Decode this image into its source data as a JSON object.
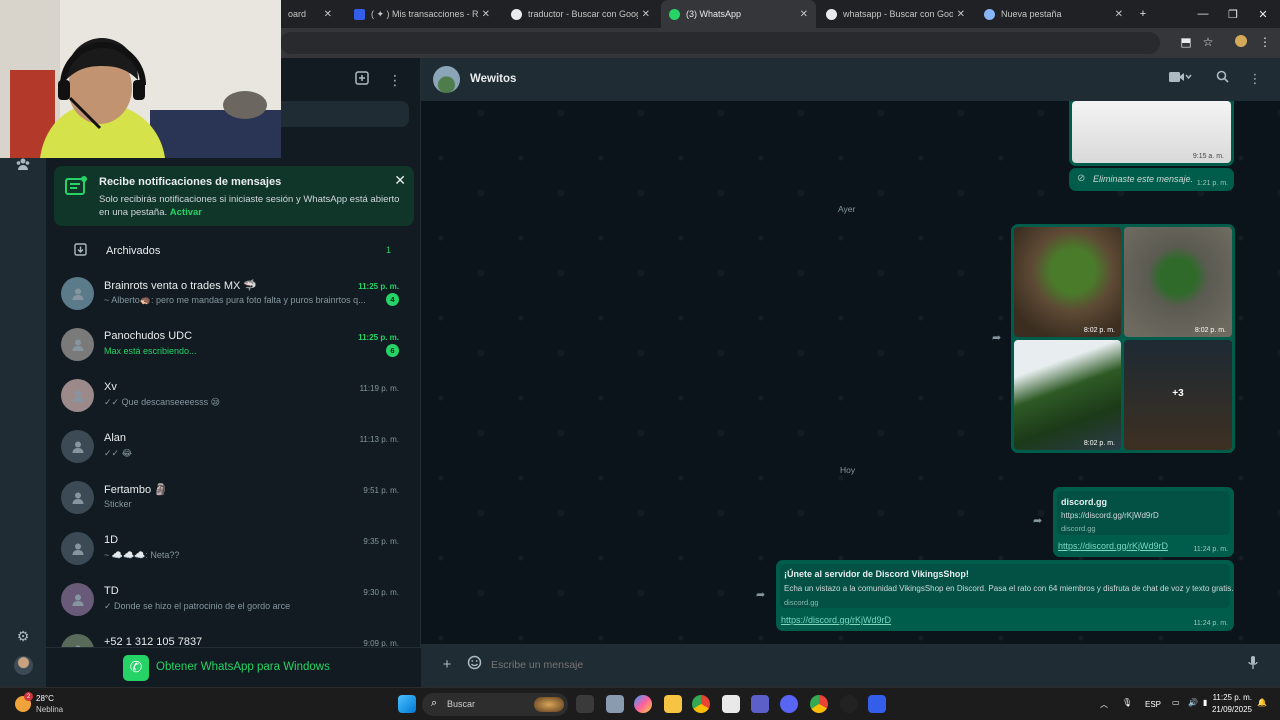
{
  "browser": {
    "tabs": [
      {
        "label": "oard",
        "active": false,
        "color": "#5f6368"
      },
      {
        "label": "( ✦ ) Mis transacciones - Roblo",
        "active": false,
        "color": "#335eea"
      },
      {
        "label": "traductor - Buscar con Google",
        "active": false,
        "color": "#e8eaed"
      },
      {
        "label": "(3) WhatsApp",
        "active": true,
        "color": "#25d366"
      },
      {
        "label": "whatsapp - Buscar con Google",
        "active": false,
        "color": "#e8eaed"
      },
      {
        "label": "Nueva pestaña",
        "active": false,
        "color": "#8ab4f8"
      }
    ],
    "new_tab_symbol": "+"
  },
  "notification": {
    "title": "Recibe notificaciones de mensajes",
    "body": "Solo recibirás notificaciones si iniciaste sesión y WhatsApp está abierto en una pestaña.",
    "action": "Activar"
  },
  "archived": {
    "label": "Archivados",
    "count": "1"
  },
  "chats": [
    {
      "name": "Brainrots venta o trades MX 🦈",
      "time": "11:25 p. m.",
      "time_green": true,
      "preview": "~ Alberto🦔: pero me mandas pura foto falta y puros brainrtos q...",
      "preview_green": false,
      "badge": "4",
      "avatar": "#5b7a8a"
    },
    {
      "name": "Panochudos UDC",
      "time": "11:25 p. m.",
      "time_green": true,
      "preview": "Max está escribiendo...",
      "preview_green": true,
      "badge": "6",
      "avatar": "#7a7a7a"
    },
    {
      "name": "Xv",
      "time": "11:19 p. m.",
      "time_green": false,
      "preview": "✓✓ Que descanseeeesss 😪",
      "preview_green": false,
      "badge": "",
      "avatar": "#9c8a8a"
    },
    {
      "name": "Alan",
      "time": "11:13 p. m.",
      "time_green": false,
      "preview": "✓✓ 😂",
      "preview_green": false,
      "badge": "",
      "avatar": "#3b4a54"
    },
    {
      "name": "Fertambo 🗿",
      "time": "9:51 p. m.",
      "time_green": false,
      "preview": "Sticker",
      "preview_green": false,
      "badge": "",
      "avatar": "#3b4a54"
    },
    {
      "name": "1D",
      "time": "9:35 p. m.",
      "time_green": false,
      "preview": "~ ☁️☁️☁️: Neta??",
      "preview_green": false,
      "badge": "",
      "avatar": "#3b4a54"
    },
    {
      "name": "TD",
      "time": "9:30 p. m.",
      "time_green": false,
      "preview": "✓ Donde se hizo el patrocinio de el gordo arce",
      "preview_green": false,
      "badge": "",
      "avatar": "#6a5a7a"
    },
    {
      "name": "+52 1 312 105 7837",
      "time": "9:09 p. m.",
      "time_green": false,
      "preview": "",
      "preview_green": false,
      "badge": "",
      "avatar": "#5a6a5a"
    }
  ],
  "get_app": {
    "label": "Obtener WhatsApp para Windows"
  },
  "chat": {
    "name": "Wewitos",
    "messages": {
      "top_image_time": "9:15 a. m.",
      "deleted_text": "Eliminaste este mensaje.",
      "deleted_time": "1:21 p. m.",
      "day_yesterday": "Ayer",
      "album_times": [
        "8:02 p. m.",
        "8:02 p. m.",
        "8:02 p. m."
      ],
      "album_more": "+3",
      "day_today": "Hoy",
      "msg1": {
        "title": "discord.gg",
        "desc": "https://discord.gg/rKjWd9rD",
        "domain": "discord.gg",
        "link": "https://discord.gg/rKjWd9rD",
        "time": "11:24 p. m."
      },
      "msg2": {
        "title": "¡Únete al servidor de Discord VikingsShop!",
        "desc": "Echa un vistazo a la comunidad VikingsShop en Discord. Pasa el rato con 64 miembros y disfruta de chat de voz y texto gratis.",
        "domain": "discord.gg",
        "link": "https://discord.gg/rKjWd9rD",
        "time": "11:24 p. m."
      }
    },
    "composer_placeholder": "Escribe un mensaje"
  },
  "taskbar": {
    "weather_temp": "28°C",
    "weather_desc": "Neblina",
    "weather_badge": "2",
    "search_label": "Buscar",
    "lang": "ESP",
    "time": "11:25 p. m.",
    "date": "21/09/2025"
  }
}
